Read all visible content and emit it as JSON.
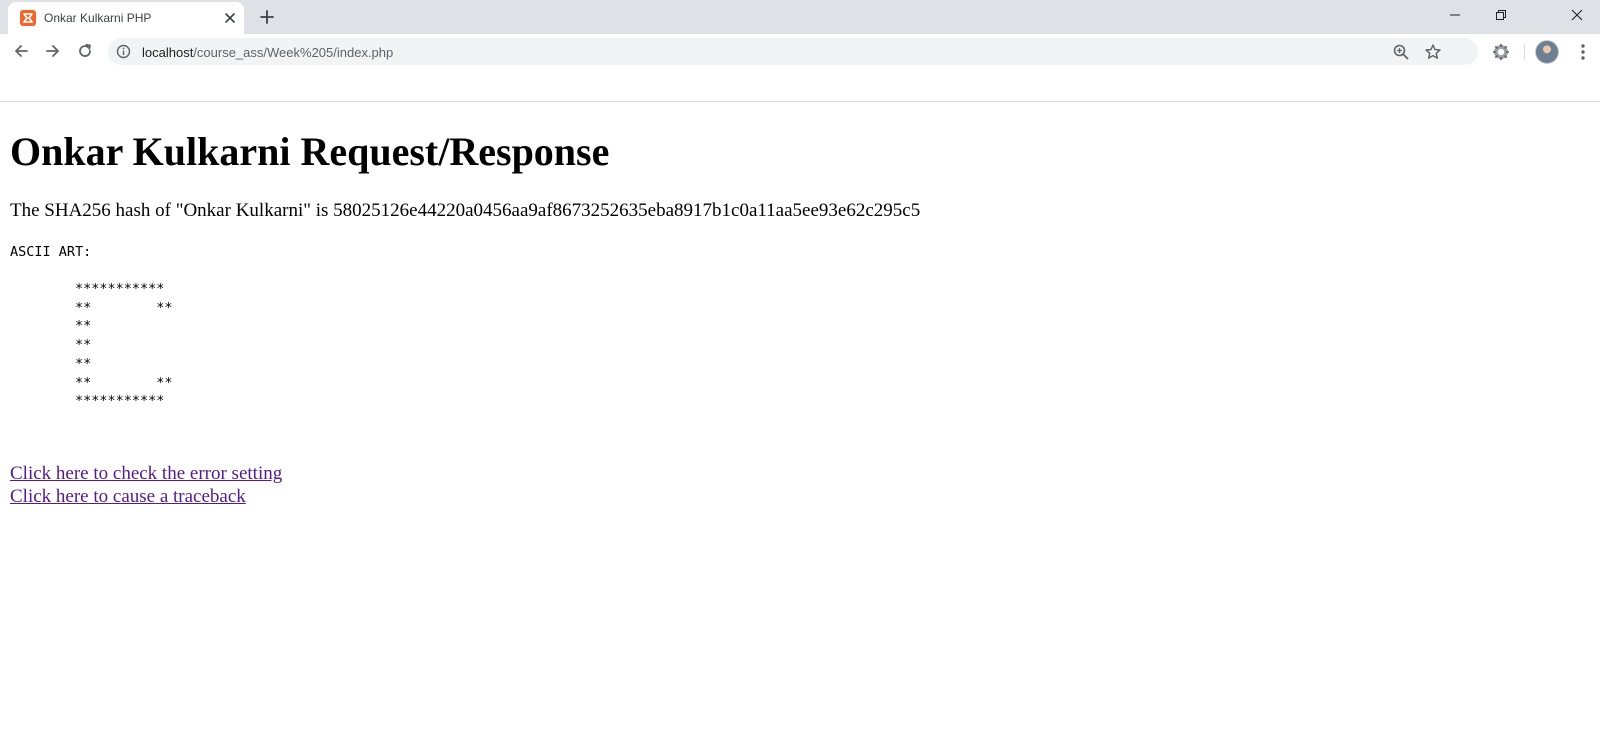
{
  "browser": {
    "tab": {
      "title": "Onkar Kulkarni PHP",
      "favicon": "xampp-icon"
    },
    "address_bar": {
      "host": "localhost",
      "path": "/course_ass/Week%205/index.php"
    },
    "toolbar_icons": [
      "back-icon",
      "forward-icon",
      "reload-icon",
      "info-icon",
      "zoom-icon",
      "star-icon",
      "extension-icon",
      "avatar",
      "menu-icon"
    ],
    "window_controls": [
      "minimize-icon",
      "restore-icon",
      "close-icon"
    ]
  },
  "page": {
    "title": "Onkar Kulkarni Request/Response",
    "hash_text": "The SHA256 hash of \"Onkar Kulkarni\" is 58025126e44220a0456aa9af8673252635eba8917b1c0a11aa5ee93e62c295c5",
    "ascii_label": "ASCII ART:",
    "ascii_art": "\t***********\n\t**\t  **\n\t**\n\t**\n\t**\n\t**\t  **\n\t***********",
    "links": [
      {
        "label": "Click here to check the error setting"
      },
      {
        "label": "Click here to cause a traceback"
      }
    ]
  },
  "colors": {
    "tabstrip": "#dee1e6",
    "omnibox": "#f1f3f4",
    "link_visited": "#551a8b",
    "favicon": "#f16529"
  }
}
